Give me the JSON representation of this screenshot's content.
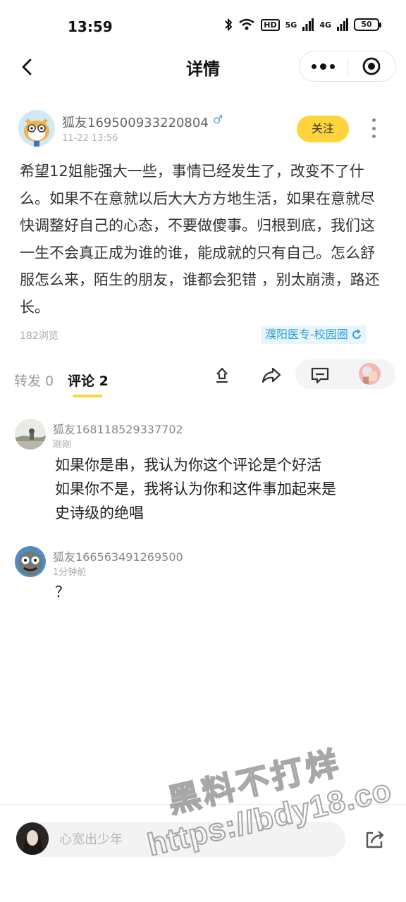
{
  "status_bar": {
    "time": "13:59",
    "net1": "5G",
    "net2": "4G",
    "hd": "HD",
    "battery": "50"
  },
  "nav": {
    "title": "详情"
  },
  "post": {
    "author": "狐友169500933220804",
    "time": "11-22 13:56",
    "follow_label": "关注",
    "content": "希望12姐能强大一些，事情已经发生了，改变不了什么。如果不在意就以后大大方方地生活，如果在意就尽快调整好自己的心态，不要做傻事。归根到底，我们这一生不会真正成为谁的谁，能成就的只有自己。怎么舒服怎么来，陌生的朋友，谁都会犯错 ，别太崩溃，路还长。",
    "views": "182浏览",
    "circle": "濮阳医专-校园圈"
  },
  "tabs": {
    "forward": "转发 0",
    "comment": "评论 2"
  },
  "comments": [
    {
      "name": "狐友168118529337702",
      "time": "刚刚",
      "text_lines": [
        "如果你是串，我认为你这个评论是个好活",
        "如果你不是，我将认为你和这件事加起来是",
        "史诗级的绝唱"
      ]
    },
    {
      "name": "狐友166563491269500",
      "time": "1分钟前",
      "text_lines": [
        "？"
      ]
    }
  ],
  "bottom": {
    "input_placeholder": "心宽出少年"
  },
  "watermark": {
    "line1": "黑料不打烊",
    "line2": "https://bdy18.co"
  },
  "colors": {
    "accent_yellow": "#ffd43a",
    "tag_blue": "#31a0d8",
    "tag_bg": "#e8f6fc",
    "male_blue": "#4aa3ef"
  },
  "icons": [
    "back-icon",
    "more-icon",
    "target-icon",
    "male-icon",
    "refresh-icon",
    "repost-icon",
    "share-icon",
    "message-icon",
    "kebab-icon"
  ]
}
